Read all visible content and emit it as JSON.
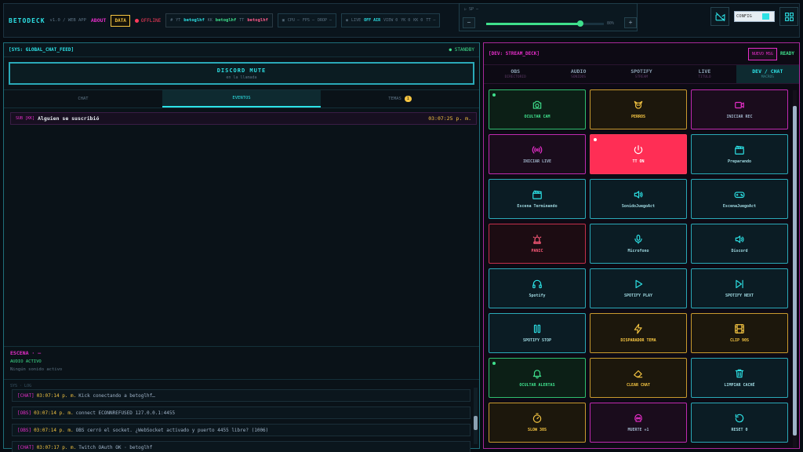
{
  "topbar": {
    "title": "BETODECK",
    "version": "v1.0 / WEB APP",
    "about": "ABOUT",
    "data_btn": "DATA",
    "status": "OFFLINE",
    "accounts": [
      {
        "label": "YT",
        "value": "betoglhf"
      },
      {
        "label": "KK",
        "value": "betoglhf"
      },
      {
        "label": "TT",
        "value": "betoglhf"
      }
    ],
    "stats": {
      "cpu": "CPU —",
      "fps": "FPS —",
      "drop": "DROP —"
    },
    "live": {
      "label": "LIVE",
      "value": "OFF AIR",
      "views": "VIEW 0",
      "yt": "YK 0",
      "kk": "KK 0",
      "tt": "TT —"
    },
    "volume": {
      "label": "SP",
      "percent_label": "80%",
      "level": 0.8,
      "minus": "−",
      "plus": "+"
    },
    "config_label": "CONFIG"
  },
  "left": {
    "header_title": "[SYS: GLOBAL_CHAT_FEED]",
    "header_status": "● STANDBY",
    "mute_title": "DISCORD MUTE",
    "mute_sub": "en la llamada",
    "tabs": [
      {
        "label": "CHAT"
      },
      {
        "label": "EVENTOS"
      },
      {
        "label": "TEMAS",
        "badge": "1"
      }
    ],
    "event": {
      "tag": "SUB [KK]",
      "message": "Alguien se suscribió",
      "time": "03:07:25 p. m."
    },
    "escena_title": "ESCENA · —",
    "audio_label": "AUDIO ACTIVO",
    "audio_status": "Ningún sonido activo",
    "logs_title": "SYS · LOG",
    "logs": [
      {
        "src": "[CHAT]",
        "time": "03:07:14 p. m.",
        "text": "Kick conectando a betoglhf…"
      },
      {
        "src": "[OBS]",
        "time": "03:07:14 p. m.",
        "text": "connect ECONNREFUSED 127.0.0.1:4455"
      },
      {
        "src": "[OBS]",
        "time": "03:07:14 p. m.",
        "text": "OBS cerró el socket. ¿WebSocket activado y puerto 4455 libre? (1006)"
      },
      {
        "src": "[CHAT]",
        "time": "03:07:17 p. m.",
        "text": "Twitch OAuth OK · betoglhf"
      }
    ]
  },
  "right": {
    "header_title": "[DEV: STREAM_DECK]",
    "nuevo_btn": "NUEVO MSG",
    "ready": "READY",
    "tabs": [
      {
        "name": "OBS",
        "sub": "DIRECTORIO"
      },
      {
        "name": "AUDIO",
        "sub": "SONIDOS"
      },
      {
        "name": "SPOTIFY",
        "sub": "STREAM"
      },
      {
        "name": "LIVE",
        "sub": "TITULO"
      },
      {
        "name": "DEV / CHAT",
        "sub": "MACROS"
      }
    ],
    "buttons": [
      {
        "label": "OCULTAR CAM",
        "icon": "camera-icon",
        "color": "green",
        "led": "#3fe08c"
      },
      {
        "label": "PERROS",
        "icon": "dog-icon",
        "color": "gold"
      },
      {
        "label": "INICIAR REC",
        "icon": "video-icon",
        "color": "mag"
      },
      {
        "label": "INICIAR LIVE",
        "icon": "broadcast-icon",
        "color": "mag"
      },
      {
        "label": "TT ON",
        "icon": "power-icon",
        "color": "live",
        "led": "#ffffff"
      },
      {
        "label": "Preparando",
        "icon": "clapper-icon",
        "color": "cyan"
      },
      {
        "label": "Escena Terminando",
        "icon": "clapper-icon",
        "color": "cyan"
      },
      {
        "label": "SonidoJuegoAct",
        "icon": "speaker-icon",
        "color": "cyan"
      },
      {
        "label": "EscenaJuegoAct",
        "icon": "gamepad-icon",
        "color": "cyan"
      },
      {
        "label": "PANIC",
        "icon": "alarm-icon",
        "color": "red"
      },
      {
        "label": "Microfono",
        "icon": "mic-icon",
        "color": "cyan"
      },
      {
        "label": "Discord",
        "icon": "speaker-icon",
        "color": "cyan"
      },
      {
        "label": "Spotify",
        "icon": "headphones-icon",
        "color": "cyan"
      },
      {
        "label": "SPOTIFY PLAY",
        "icon": "play-icon",
        "color": "cyan"
      },
      {
        "label": "SPOTIFY NEXT",
        "icon": "next-icon",
        "color": "cyan"
      },
      {
        "label": "SPOTIFY STOP",
        "icon": "pause-icon",
        "color": "cyan"
      },
      {
        "label": "DISPARADOR TEMA",
        "icon": "lightning-icon",
        "color": "gold"
      },
      {
        "label": "CLIP 90S",
        "icon": "film-icon",
        "color": "gold"
      },
      {
        "label": "OCULTAR ALERTAS",
        "icon": "bell-icon",
        "color": "green",
        "led": "#3fe08c"
      },
      {
        "label": "CLEAR CHAT",
        "icon": "eraser-icon",
        "color": "gold"
      },
      {
        "label": "LIMPIAR CACHÉ",
        "icon": "trash-icon",
        "color": "cyan"
      },
      {
        "label": "SLOW 30S",
        "icon": "timer-icon",
        "color": "gold"
      },
      {
        "label": "MUERTE +1",
        "icon": "skull-icon",
        "color": "mag"
      },
      {
        "label": "RESET 0",
        "icon": "reset-icon",
        "color": "cyan"
      }
    ]
  }
}
